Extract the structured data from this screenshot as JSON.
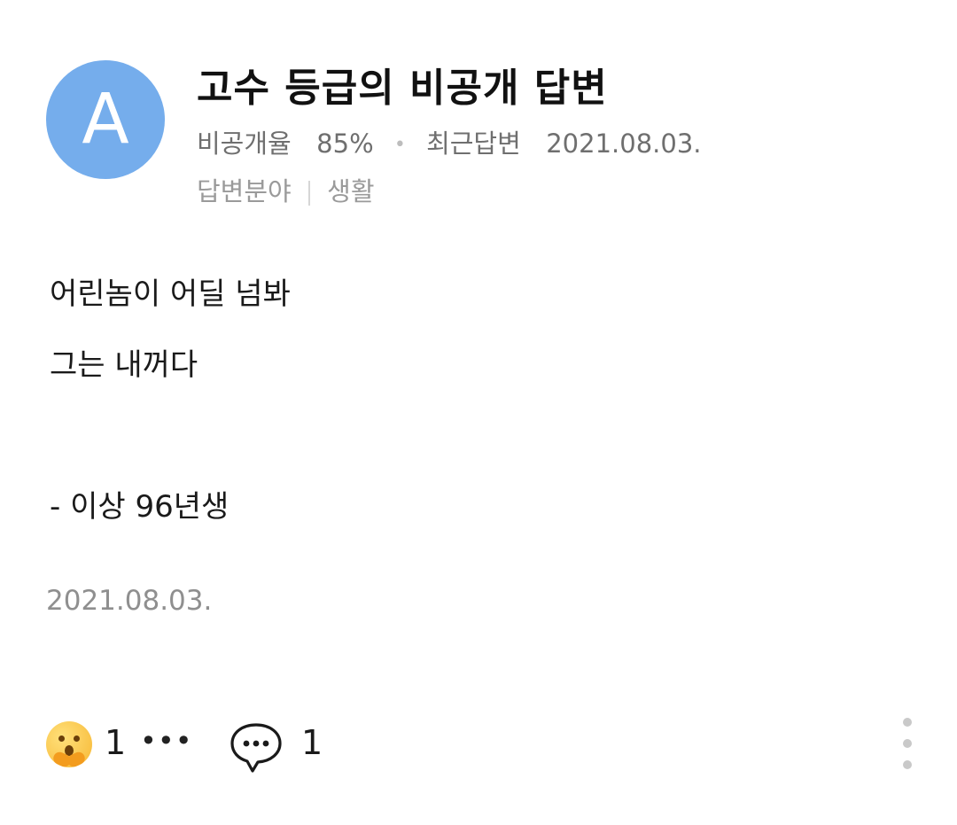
{
  "header": {
    "avatar_letter": "A",
    "avatar_color": "#75adec",
    "title": "고수 등급의 비공개 답변",
    "private_rate_label": "비공개율",
    "private_rate_value": "85%",
    "dot": "•",
    "recent_answer_label": "최근답변",
    "recent_answer_date": "2021.08.03.",
    "field_label": "답변분야",
    "field_value": "생활"
  },
  "body": {
    "lines": [
      "어린놈이 어딜 넘봐",
      "그는 내꺼다",
      "",
      "- 이상 96년생"
    ]
  },
  "date": "2021.08.03.",
  "actions": {
    "reaction_icon": "shushing-face-emoji",
    "reaction_count": "1",
    "more": "•••",
    "comment_icon": "speech-bubble-icon",
    "comment_count": "1",
    "menu_icon": "vertical-ellipsis-icon"
  }
}
